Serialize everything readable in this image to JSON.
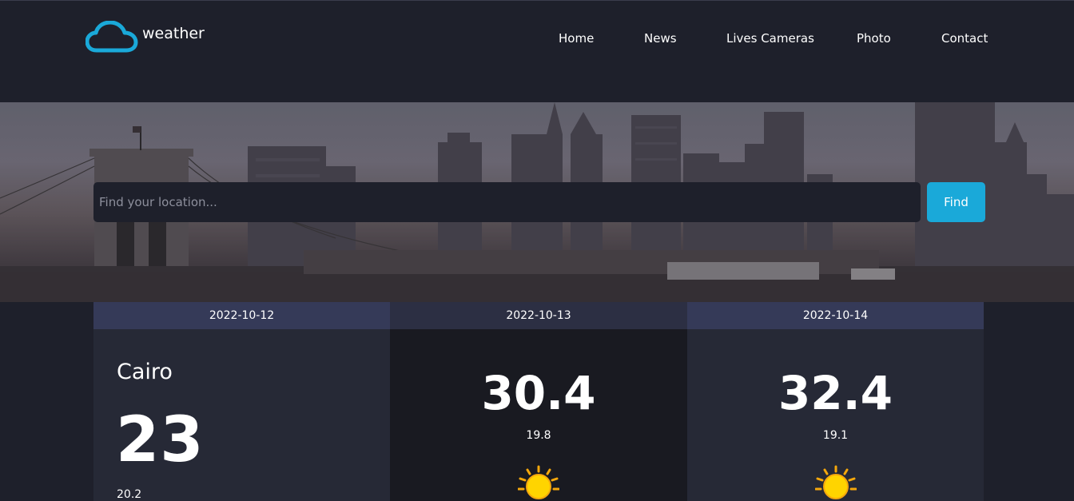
{
  "brand": {
    "name": "weather",
    "accent": "#1aa9d9"
  },
  "nav": {
    "items": [
      {
        "label": "Home"
      },
      {
        "label": "News"
      },
      {
        "label": "Lives Cameras"
      },
      {
        "label": "Photo"
      },
      {
        "label": "Contact"
      }
    ]
  },
  "search": {
    "placeholder": "Find your location...",
    "value": "",
    "button_label": "Find"
  },
  "forecast": {
    "days": [
      {
        "date": "2022-10-12",
        "city": "Cairo",
        "max_temp": "23",
        "min_temp": "20.2"
      },
      {
        "date": "2022-10-13",
        "max_temp": "30.4",
        "min_temp": "19.8",
        "icon": "sun-icon"
      },
      {
        "date": "2022-10-14",
        "max_temp": "32.4",
        "min_temp": "19.1",
        "icon": "sun-icon"
      }
    ]
  },
  "colors": {
    "background": "#1e202b",
    "card_header": "#353a58",
    "card_body": "#262936",
    "card_body_alt": "#191a21"
  }
}
